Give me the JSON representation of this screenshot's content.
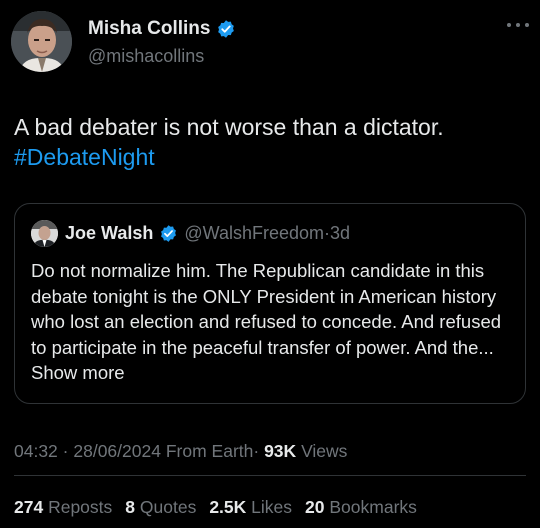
{
  "post": {
    "author": {
      "name": "Misha Collins",
      "handle": "@mishacollins",
      "verified_color": "#1d9bf0"
    },
    "text": "A bad debater is not worse than a dictator.",
    "hashtag": "#DebateNight",
    "quote": {
      "author_name": "Joe Walsh",
      "author_handle": "@WalshFreedom",
      "separator": "·",
      "age": "3d",
      "text": "Do not normalize him. The Republican candidate in this debate tonight is the ONLY President in American history who lost an election and refused to concede. And refused to participate in the peaceful transfer of power. And the...",
      "show_more": "Show more"
    },
    "meta": {
      "time": "04:32",
      "sep1": "·",
      "date": "28/06/2024",
      "source": "From Earth",
      "sep2": "·",
      "views_count": "93K",
      "views_label": "Views"
    },
    "stats": {
      "reposts_count": "274",
      "reposts_label": "Reposts",
      "quotes_count": "8",
      "quotes_label": "Quotes",
      "likes_count": "2.5K",
      "likes_label": "Likes",
      "bookmarks_count": "20",
      "bookmarks_label": "Bookmarks"
    }
  },
  "icons": {
    "verified": "verified-badge-icon",
    "more": "more-options-icon"
  },
  "colors": {
    "background": "#000000",
    "text": "#e7e9ea",
    "secondary": "#71767b",
    "accent": "#1d9bf0",
    "border": "#2f3336"
  }
}
